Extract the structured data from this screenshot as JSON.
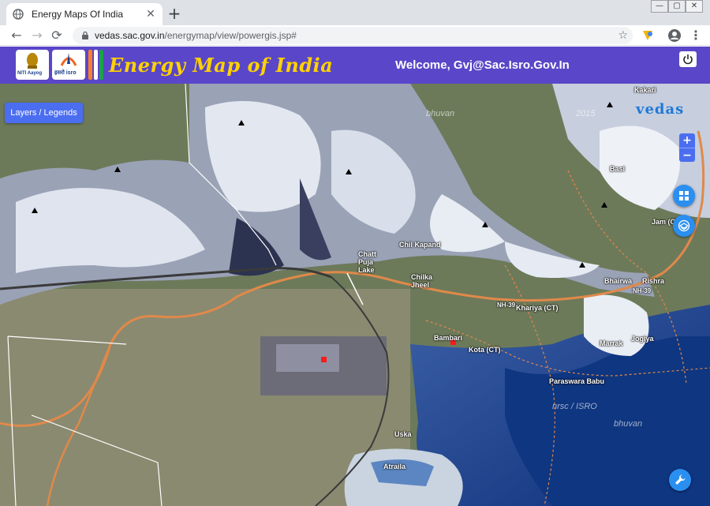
{
  "browser": {
    "tab_title": "Energy Maps Of India",
    "url_host": "vedas.sac.gov.in",
    "url_path": "/energymap/view/powergis.jsp#",
    "new_tab": "+",
    "tab_close": "✕",
    "back": "←",
    "forward": "→",
    "reload": "⟳",
    "star": "☆",
    "menu": "⋮",
    "win_min": "—",
    "win_max": "▢",
    "win_close": "✕"
  },
  "header": {
    "niti_label": "NITI Aayog",
    "isro_label": "इसरो isro",
    "app_title": "Energy Map of India",
    "welcome": "Welcome, Gvj@Sac.Isro.Gov.In",
    "flag_colors": [
      "#ff7f27",
      "#ffffff",
      "#1aa34a"
    ]
  },
  "map": {
    "layers_button": "Layers / Legends",
    "zoom_in": "+",
    "zoom_out": "−",
    "vedas_logo": "vedas",
    "watermark_bhuvan": "bhuvan",
    "watermark_bhuvan2": "bhuvan",
    "watermark_nrsc": "nrsc / ISRO",
    "watermark_year": "2015",
    "labels": {
      "kakari": "Kakari",
      "basi": "Basi",
      "jam": "Jam (CT)",
      "chil_kapand": "Chil Kapand",
      "chatt_puja_lake": "Chatt\nPuja\nLake",
      "chilka_jheel": "Chilka\nJheel",
      "nh39_left": "NH-39",
      "khariya": "Khariya (CT)",
      "nh39_right": "NH-39",
      "bhairwa": "Bhairwa",
      "rishra": "Rishra",
      "bambari": "Bambari",
      "kota": "Kota (CT)",
      "marrak": "Marrak",
      "jogiya": "Jogiya",
      "paraswara_babu": "Paraswara Babu",
      "uska": "Uska",
      "atraila": "Atraila"
    },
    "colors": {
      "road": "#e0894a",
      "button": "#4b6ef0",
      "round_button": "#2a8ff0",
      "marker_red": "#ff1a1a"
    },
    "icons": {
      "grid": "grid-icon",
      "layers": "layers-icon",
      "wrench": "wrench-icon",
      "power": "power-icon"
    }
  }
}
